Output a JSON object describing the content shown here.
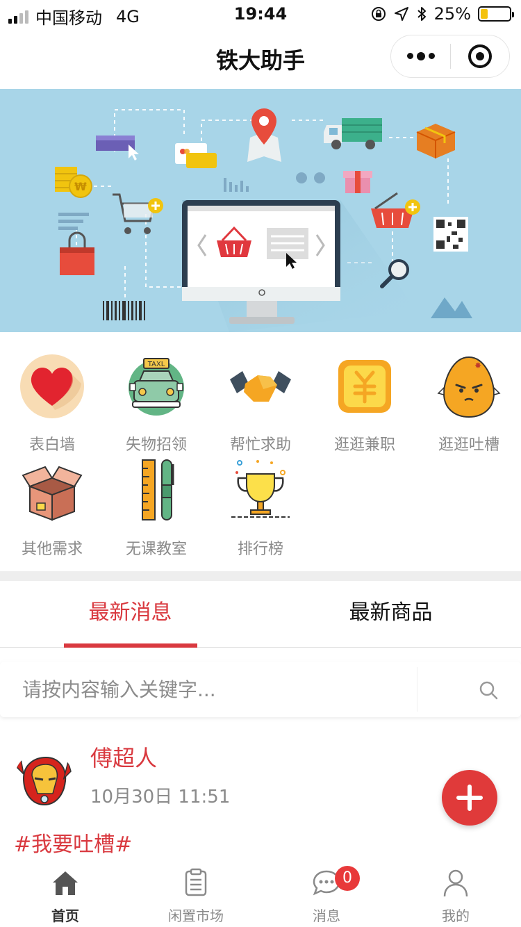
{
  "status_bar": {
    "carrier": "中国移动",
    "network": "4G",
    "time": "19:44",
    "battery": "25%",
    "battery_level": 0.25
  },
  "nav": {
    "title": "铁大助手"
  },
  "grid": {
    "items": [
      {
        "label": "表白墙",
        "icon": "heart-icon"
      },
      {
        "label": "失物招领",
        "icon": "taxi-icon"
      },
      {
        "label": "帮忙求助",
        "icon": "handshake-icon"
      },
      {
        "label": "逛逛兼职",
        "icon": "yen-coin-icon"
      },
      {
        "label": "逛逛吐槽",
        "icon": "angry-egg-icon"
      },
      {
        "label": "其他需求",
        "icon": "box-icon"
      },
      {
        "label": "无课教室",
        "icon": "ruler-pen-icon"
      },
      {
        "label": "排行榜",
        "icon": "trophy-icon"
      }
    ]
  },
  "tabs": {
    "latest_news": "最新消息",
    "latest_goods": "最新商品"
  },
  "search": {
    "placeholder": "请按内容输入关键字..."
  },
  "post": {
    "author": "傅超人",
    "time": "10月30日 11:51",
    "tag": "#我要吐槽#"
  },
  "tab_bar": {
    "items": [
      {
        "label": "首页",
        "icon": "home-icon"
      },
      {
        "label": "闲置市场",
        "icon": "clipboard-icon"
      },
      {
        "label": "消息",
        "icon": "chat-icon"
      },
      {
        "label": "我的",
        "icon": "user-icon"
      }
    ],
    "message_badge": "0"
  },
  "colors": {
    "accent": "#d9393f",
    "banner_bg": "#a8d5e8"
  }
}
